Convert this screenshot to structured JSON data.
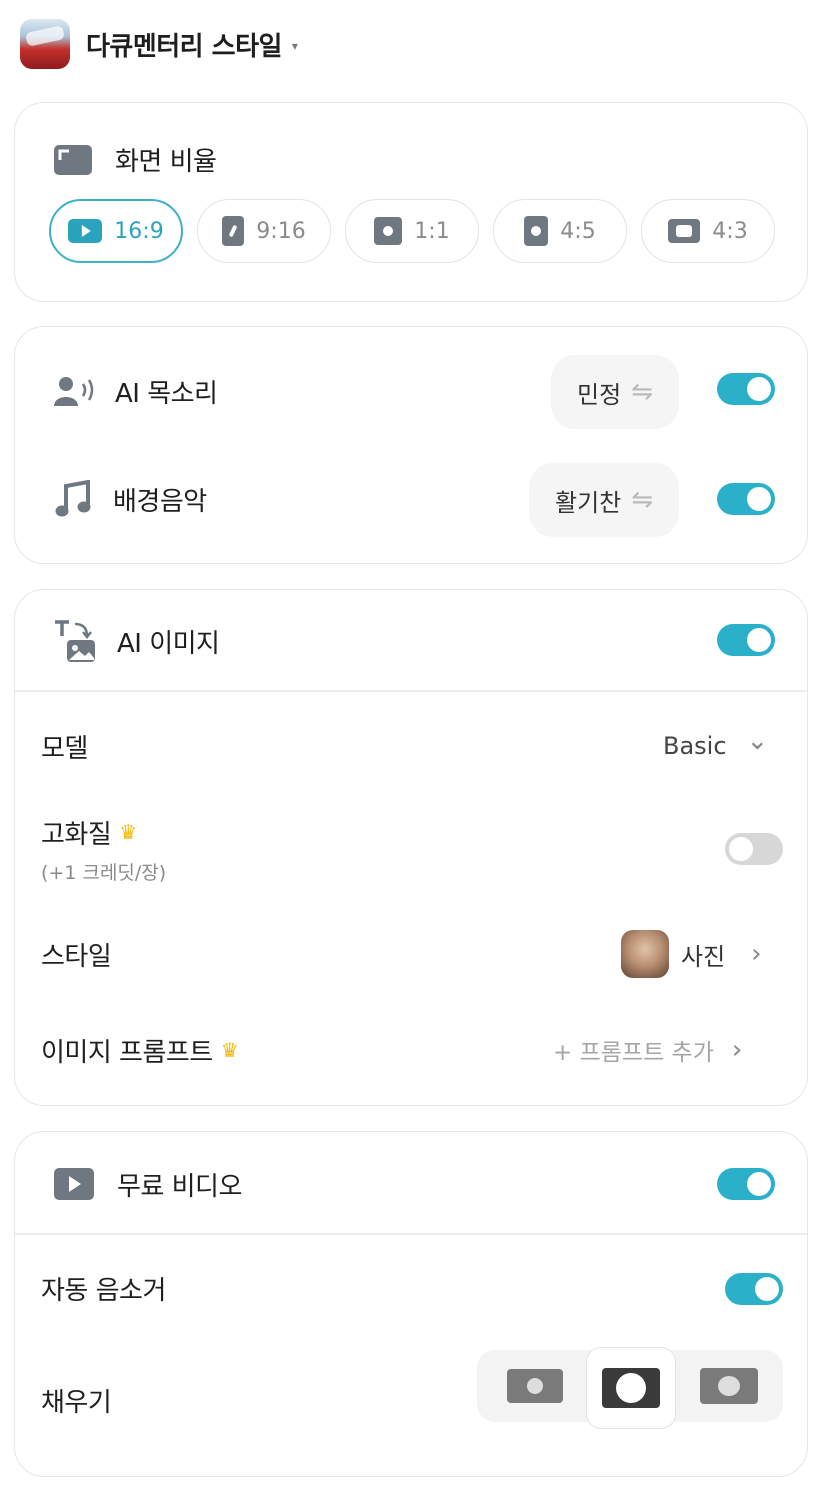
{
  "header": {
    "title": "다큐멘터리 스타일",
    "caret": "▾"
  },
  "aspect": {
    "label": "화면 비율",
    "options": [
      {
        "label": "16:9",
        "active": true
      },
      {
        "label": "9:16",
        "active": false
      },
      {
        "label": "1:1",
        "active": false
      },
      {
        "label": "4:5",
        "active": false
      },
      {
        "label": "4:3",
        "active": false
      }
    ]
  },
  "audio": {
    "voice": {
      "label": "AI 목소리",
      "value": "민정",
      "swap": "⇋",
      "enabled": true
    },
    "music": {
      "label": "배경음악",
      "value": "활기찬",
      "swap": "⇋",
      "enabled": true
    }
  },
  "ai_image": {
    "label": "AI 이미지",
    "enabled": true,
    "model": {
      "label": "모델",
      "value": "Basic",
      "chevron": "⌄"
    },
    "hq": {
      "label": "고화질",
      "note": "(+1 크레딧/장)",
      "crown": "♛",
      "enabled": false
    },
    "style": {
      "label": "스타일",
      "value": "사진",
      "chevron": "›"
    },
    "prompt": {
      "label": "이미지 프롬프트",
      "crown": "♛",
      "value": "+ 프롬프트 추가",
      "chevron": "›"
    }
  },
  "free_video": {
    "label": "무료 비디오",
    "enabled": true,
    "mute": {
      "label": "자동 음소거",
      "enabled": true
    },
    "fill": {
      "label": "채우기",
      "selected": 1
    }
  },
  "colors": {
    "accent": "#2ab0c9",
    "icon": "#6f7780",
    "crown": "#f2b705"
  }
}
